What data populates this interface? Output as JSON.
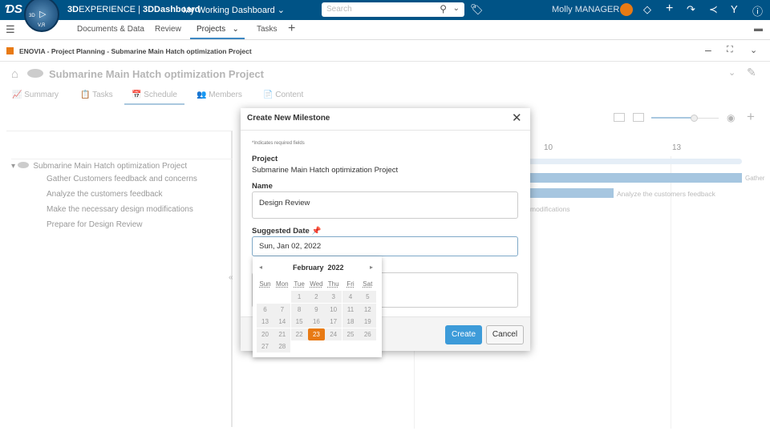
{
  "topbar": {
    "brand_bold": "3D",
    "brand_rest": "EXPERIENCE | ",
    "app": "3DDashboard",
    "dashboard": "My Working Dashboard",
    "search_placeholder": "Search",
    "user": "Molly MANAGER",
    "compass_labels": [
      "3D",
      "V,R"
    ]
  },
  "tabs": [
    {
      "label": "Documents & Data"
    },
    {
      "label": "Review"
    },
    {
      "label": "Projects",
      "active": true
    },
    {
      "label": "Tasks"
    }
  ],
  "widget": {
    "title": "ENOVIA - Project Planning - Submarine Main Hatch optimization Project"
  },
  "project": {
    "title": "Submarine Main Hatch optimization Project",
    "tabs": [
      "Summary",
      "Tasks",
      "Schedule",
      "Members",
      "Content"
    ],
    "active_tab": "Schedule"
  },
  "tree": {
    "root": "Submarine Main Hatch optimization Project",
    "tasks": [
      "Gather Customers feedback and concerns",
      "Analyze the customers feedback",
      "Make the necessary design modifications",
      "Prepare for Design Review"
    ]
  },
  "gantt": {
    "ticks": [
      "10",
      "13"
    ],
    "bar_labels": [
      "Gather",
      "Analyze the customers feedback",
      "modifications"
    ],
    "zoom_level": 0.7
  },
  "modal": {
    "title": "Create New Milestone",
    "required_note": "*Indicates required fields",
    "project_label": "Project",
    "project_value": "Submarine Main Hatch optimization Project",
    "name_label": "Name",
    "name_value": "Design Review",
    "date_label": "Suggested Date",
    "date_value": "Sun, Jan 02, 2022",
    "create": "Create",
    "cancel": "Cancel"
  },
  "calendar": {
    "month": "February",
    "year": "2022",
    "weekdays": [
      "Sun",
      "Mon",
      "Tue",
      "Wed",
      "Thu",
      "Fri",
      "Sat"
    ],
    "first_weekday": 2,
    "days": 28,
    "selected": 23
  },
  "colors": {
    "topbar": "#005386",
    "accent": "#3d9bd9",
    "selected_day": "#e87a14"
  }
}
